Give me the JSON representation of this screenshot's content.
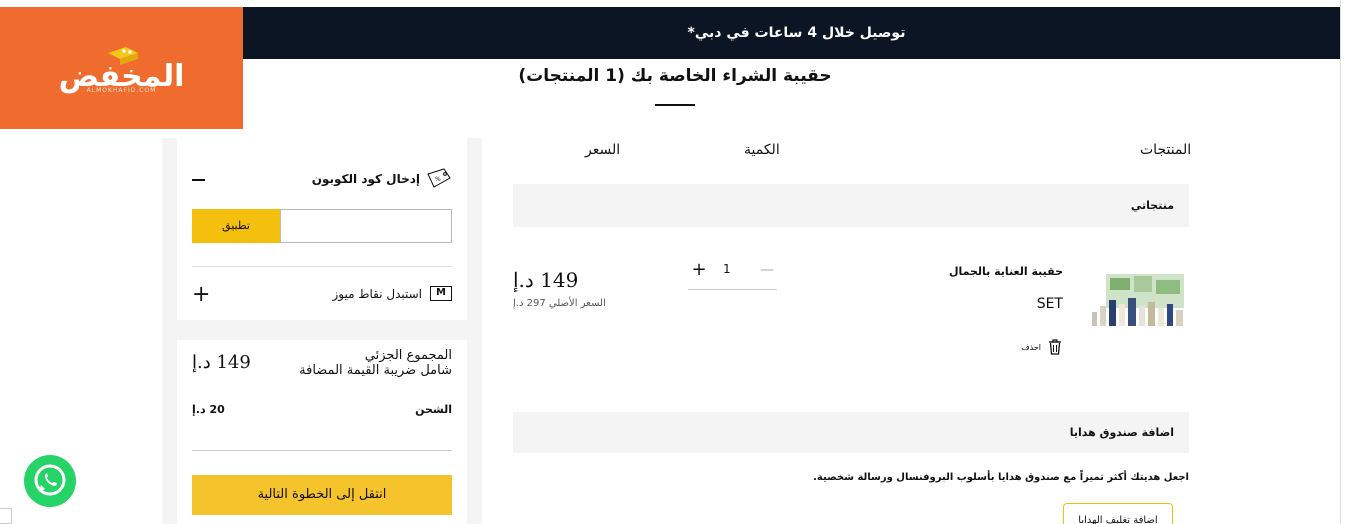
{
  "topbar": {
    "delivery_text": "توصيل خلال 4 ساعات في دبي*"
  },
  "logo": {
    "text": "المخفض",
    "subtext": "ALMOKHAFID.COM"
  },
  "cart": {
    "title": "حقيبة الشراء الخاصة بك (1 المنتجات)",
    "columns": {
      "products": "المنتجات",
      "quantity": "الكمية",
      "price": "السعر"
    },
    "group_label": "منتجاتي",
    "item": {
      "name": "حقيبة العناية بالجمال",
      "variant": "SET",
      "delete_label": "احذف",
      "quantity": "1",
      "price": "149 د.إ",
      "original_price": "السعر الأصلي 297 د.إ"
    },
    "gift_box": {
      "title": "اضافة صندوق هدايا",
      "description": "اجعل هديتك أكثر تميزاً مع صندوق هدايا بأسلوب البروفنسال ورسالة شخصية.",
      "button_label": "اضافة تغليف الهدايا"
    }
  },
  "coupon": {
    "label": "إدخال كود الكوبون",
    "input_value": "",
    "apply_label": "تطبيق",
    "miles_label": "استبدل نقاط ميوز",
    "miles_badge": "M"
  },
  "summary": {
    "subtotal_label": "المجموع الجزئي",
    "vat_label": "شامل ضريبة القيمة المضافة",
    "subtotal_value": "149 د.إ",
    "shipping_label": "الشحن",
    "shipping_value": "20 د.إ",
    "next_label": "انتقل إلى الخطوة التالية"
  },
  "colors": {
    "topbar": "#0c1524",
    "logo_bg": "#f06c2e",
    "accent": "#f5bf0e",
    "whatsapp": "#25d366"
  }
}
